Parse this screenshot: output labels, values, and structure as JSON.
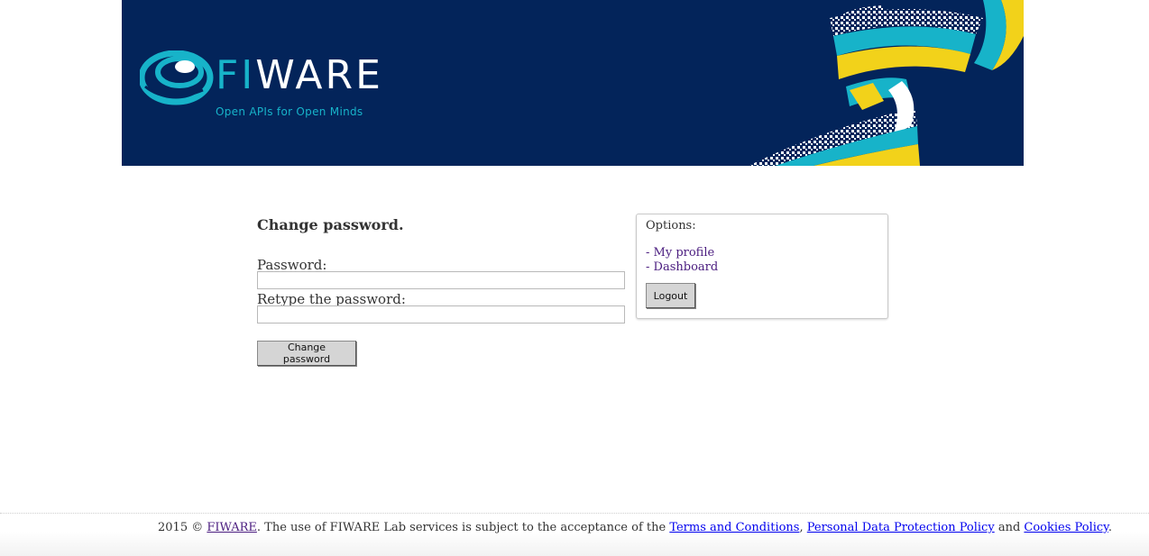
{
  "banner": {
    "logo_word_fi": "FI",
    "logo_word_rest": "WARE",
    "tagline": "Open APIs for Open Minds",
    "colors": {
      "background": "#03245a",
      "accent": "#17b3c9",
      "yellow": "#f2d21a"
    }
  },
  "form": {
    "title": "Change password.",
    "password_label": "Password:",
    "password_value": "",
    "retype_label": "Retype the password:",
    "retype_value": "",
    "submit_label": "Change password"
  },
  "options": {
    "title": "Options:",
    "links": [
      "- My profile",
      "- Dashboard"
    ],
    "logout_label": "Logout"
  },
  "footer": {
    "prefix": "2015 © ",
    "fiware_link": "FIWARE",
    "middle": ". The use of FIWARE Lab services is subject to the acceptance of the ",
    "terms_link": "Terms and Conditions",
    "sep1": ", ",
    "privacy_link": "Personal Data Protection Policy",
    "sep2": " and ",
    "cookies_link": "Cookies Policy",
    "suffix": "."
  }
}
